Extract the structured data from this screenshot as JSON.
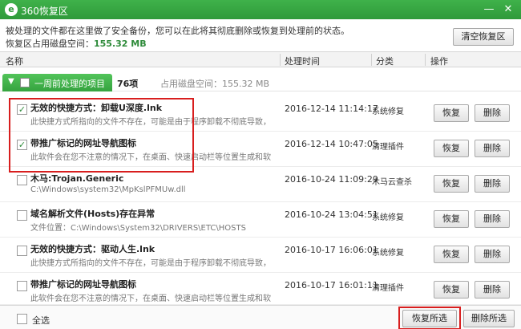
{
  "window": {
    "title": "360恢复区",
    "logo_text": "e",
    "minimize_glyph": "—",
    "close_glyph": "✕"
  },
  "info_text": "被处理的文件都在这里做了安全备份，您可以在此将其彻底删除或恢复到处理前的状态。",
  "usage": {
    "label": "恢复区占用磁盘空间：",
    "value": "155.32 MB"
  },
  "clear_button": "清空恢复区",
  "columns": {
    "name": "名称",
    "time": "处理时间",
    "category": "分类",
    "action": "操作"
  },
  "group": {
    "arrow_glyph": "▼",
    "label": "一周前处理的项目",
    "count": "76项",
    "usage": "占用磁盘空间：155.32 MB"
  },
  "rows": [
    {
      "checked": true,
      "check_glyph": "✓",
      "title": "无效的快捷方式：卸载U深度.lnk",
      "desc": "此快捷方式所指向的文件不存在，可能是由于程序卸载不彻底导致，或…",
      "time": "2016-12-14 11:14:17",
      "category": "系统修复",
      "restore": "恢复",
      "delete": "删除"
    },
    {
      "checked": true,
      "check_glyph": "✓",
      "title": "带推广标记的网址导航图标",
      "desc": "此软件会在您不注意的情况下，在桌面、快速启动栏等位置生成和软…",
      "time": "2016-12-14 10:47:05",
      "category": "清理插件",
      "restore": "恢复",
      "delete": "删除"
    },
    {
      "checked": false,
      "check_glyph": "",
      "title": "木马:Trojan.Generic",
      "desc": "C:\\Windows\\system32\\MpKslPFMUw.dll",
      "time": "2016-10-24 11:09:29",
      "category": "木马云查杀",
      "restore": "恢复",
      "delete": "删除"
    },
    {
      "checked": false,
      "check_glyph": "",
      "title": "域名解析文件(Hosts)存在异常",
      "desc": "文件位置：C:\\Windows\\System32\\DRIVERS\\ETC\\HOSTS",
      "time": "2016-10-24 13:04:51",
      "category": "系统修复",
      "restore": "恢复",
      "delete": "删除"
    },
    {
      "checked": false,
      "check_glyph": "",
      "title": "无效的快捷方式：驱动人生.lnk",
      "desc": "此快捷方式所指向的文件不存在，可能是由于程序卸载不彻底导致，或…",
      "time": "2016-10-17 16:06:01",
      "category": "系统修复",
      "restore": "恢复",
      "delete": "删除"
    },
    {
      "checked": false,
      "check_glyph": "",
      "title": "带推广标记的网址导航图标",
      "desc": "此软件会在您不注意的情况下，在桌面、快速启动栏等位置生成和软…",
      "time": "2016-10-17 16:01:11",
      "category": "清理插件",
      "restore": "恢复",
      "delete": "删除"
    }
  ],
  "footer": {
    "select_all": "全选",
    "restore_selected": "恢复所选",
    "delete_selected": "删除所选"
  },
  "colors": {
    "title_bar": "#2f9a3a",
    "accent_green": "#35a33f",
    "highlight_red": "#d81e1e"
  }
}
